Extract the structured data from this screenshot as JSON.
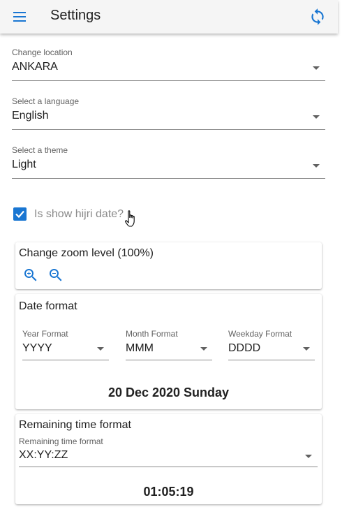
{
  "appbar": {
    "title": "Settings",
    "menu_icon": "menu-icon",
    "refresh_icon": "refresh-icon",
    "accent": "#1976d2"
  },
  "location": {
    "label": "Change location",
    "value": "ANKARA"
  },
  "language": {
    "label": "Select a language",
    "value": "English"
  },
  "theme": {
    "label": "Select a theme",
    "value": "Light"
  },
  "hijri": {
    "label": "Is show hijri date?",
    "checked": true
  },
  "zoom": {
    "title": "Change zoom level (100%)",
    "zoom_in_icon": "zoom-in-icon",
    "zoom_out_icon": "zoom-out-icon"
  },
  "date_format": {
    "title": "Date format",
    "year": {
      "label": "Year Format",
      "value": "YYYY"
    },
    "month": {
      "label": "Month Format",
      "value": "MMM"
    },
    "weekday": {
      "label": "Weekday Format",
      "value": "DDDD"
    },
    "preview": "20 Dec 2020 Sunday"
  },
  "remaining": {
    "title": "Remaining time format",
    "label": "Remaining time format",
    "value": "XX:YY:ZZ",
    "preview": "01:05:19"
  }
}
